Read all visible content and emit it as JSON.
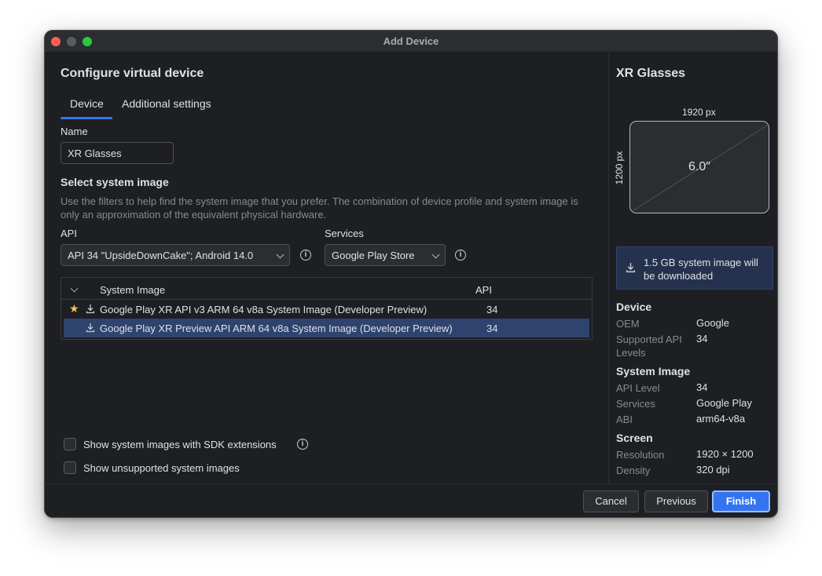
{
  "window": {
    "title": "Add Device"
  },
  "main": {
    "heading": "Configure virtual device",
    "tabs": [
      {
        "label": "Device",
        "active": true
      },
      {
        "label": "Additional settings",
        "active": false
      }
    ],
    "name_label": "Name",
    "name_value": "XR Glasses",
    "system_image_heading": "Select system image",
    "description": "Use the filters to help find the system image that you prefer. The combination of device profile and system image is only an approximation of the equivalent physical hardware.",
    "api_label": "API",
    "api_selected": "API 34 \"UpsideDownCake\"; Android 14.0",
    "services_label": "Services",
    "services_selected": "Google Play Store",
    "table": {
      "columns": [
        "System Image",
        "API"
      ],
      "rows": [
        {
          "name": "Google Play XR API v3 ARM 64 v8a System Image (Developer Preview)",
          "api": "34",
          "starred": true,
          "selected": false
        },
        {
          "name": "Google Play XR Preview API ARM 64 v8a System Image (Developer Preview)",
          "api": "34",
          "starred": false,
          "selected": true
        }
      ]
    },
    "checkbox_sdk_ext": "Show system images with SDK extensions",
    "checkbox_unsupported": "Show unsupported system images"
  },
  "side": {
    "device_name": "XR Glasses",
    "width_label": "1920 px",
    "height_label": "1200 px",
    "diagonal": "6.0″",
    "download_notice": "1.5 GB system image will be downloaded",
    "device_section": "Device",
    "oem_key": "OEM",
    "oem_value": "Google",
    "api_levels_key": "Supported API Levels",
    "api_levels_value": "34",
    "system_image_section": "System Image",
    "api_level_key": "API Level",
    "api_level_value": "34",
    "services_key": "Services",
    "services_value": "Google Play",
    "abi_key": "ABI",
    "abi_value": "arm64-v8a",
    "screen_section": "Screen",
    "resolution_key": "Resolution",
    "resolution_value": "1920 × 1200",
    "density_key": "Density",
    "density_value": "320 dpi"
  },
  "footer": {
    "cancel": "Cancel",
    "previous": "Previous",
    "finish": "Finish"
  },
  "colors": {
    "accent": "#3574f0",
    "selection": "#2e436e",
    "star": "#f2c55c"
  }
}
